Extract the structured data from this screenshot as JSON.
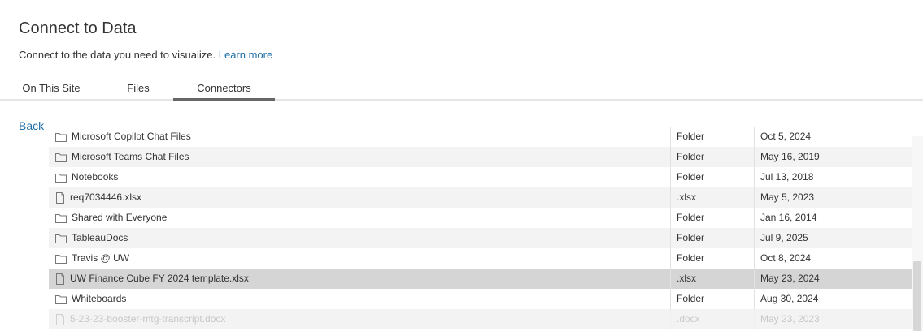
{
  "header": {
    "title": "Connect to Data",
    "subtitle": "Connect to the data you need to visualize.",
    "learn_more": "Learn more"
  },
  "tabs": [
    {
      "label": "On This Site",
      "active": false
    },
    {
      "label": "Files",
      "active": false
    },
    {
      "label": "Connectors",
      "active": true
    }
  ],
  "back_label": "Back",
  "files": [
    {
      "name": "Microsoft Copilot Chat Files",
      "type": "Folder",
      "date": "Oct 5, 2024",
      "icon": "folder-icon"
    },
    {
      "name": "Microsoft Teams Chat Files",
      "type": "Folder",
      "date": "May 16, 2019",
      "icon": "folder-icon"
    },
    {
      "name": "Notebooks",
      "type": "Folder",
      "date": "Jul 13, 2018",
      "icon": "folder-icon"
    },
    {
      "name": "req7034446.xlsx",
      "type": ".xlsx",
      "date": "May 5, 2023",
      "icon": "file-icon"
    },
    {
      "name": "Shared with Everyone",
      "type": "Folder",
      "date": "Jan 16, 2014",
      "icon": "folder-icon"
    },
    {
      "name": "TableauDocs",
      "type": "Folder",
      "date": "Jul 9, 2025",
      "icon": "folder-icon"
    },
    {
      "name": "Travis @ UW",
      "type": "Folder",
      "date": "Oct 8, 2024",
      "icon": "folder-icon"
    },
    {
      "name": "UW Finance Cube FY 2024 template.xlsx",
      "type": ".xlsx",
      "date": "May 23, 2024",
      "icon": "file-icon",
      "selected": true
    },
    {
      "name": "Whiteboards",
      "type": "Folder",
      "date": "Aug 30, 2024",
      "icon": "folder-icon"
    },
    {
      "name": "5-23-23-booster-mtg-transcript.docx",
      "type": ".docx",
      "date": "May 23, 2023",
      "icon": "file-icon",
      "faded": true
    }
  ],
  "colors": {
    "link": "#1f6fa8",
    "selected_row": "#d5d5d5",
    "alt_row": "#f3f3f3"
  }
}
